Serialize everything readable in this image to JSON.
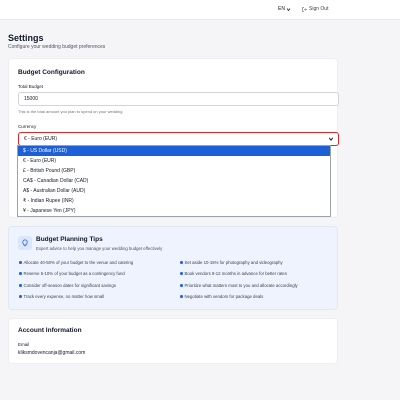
{
  "header": {
    "language": "EN",
    "sign_out": "Sign Out"
  },
  "page": {
    "title": "Settings",
    "subtitle": "Configure your wedding budget preferences"
  },
  "budget_config": {
    "title": "Budget Configuration",
    "total_label": "Total Budget",
    "total_value": "15000",
    "total_hint": "This is the total amount you plan to spend on your wedding",
    "currency_label": "Currency",
    "currency_value": "€ - Euro (EUR)",
    "currency_options": [
      "$ - US Dollar (USD)",
      "€ - Euro (EUR)",
      "£ - British Pound (GBP)",
      "CA$ - Canadian Dollar (CAD)",
      "A$ - Australian Dollar (AUD)",
      "₹ - Indian Rupee (INR)",
      "¥ - Japanese Yen (JPY)"
    ]
  },
  "tips": {
    "title": "Budget Planning Tips",
    "subtitle": "Expert advice to help you manage your wedding budget effectively",
    "items": [
      "Allocate 40-50% of your budget to the venue and catering",
      "Set aside 10-15% for photography and videography",
      "Reserve 5-10% of your budget as a contingency fund",
      "Book vendors 8-12 months in advance for better rates",
      "Consider off-season dates for significant savings",
      "Prioritize what matters most to you and allocate accordingly",
      "Track every expense, no matter how small",
      "Negotiate with vendors for package deals"
    ]
  },
  "account": {
    "title": "Account Information",
    "email_label": "Email",
    "email_value": "kliksmdovencanja@gmail.com"
  },
  "colors": {
    "accent": "#2563eb",
    "selected_option": "#1d5fd6",
    "error_border": "#dc2626",
    "tips_bg": "#eef3fd"
  },
  "icons": {
    "language": "chevron-down-icon",
    "sign_out": "sign-out-icon",
    "tips": "lightbulb-icon",
    "select": "chevron-down-icon"
  }
}
